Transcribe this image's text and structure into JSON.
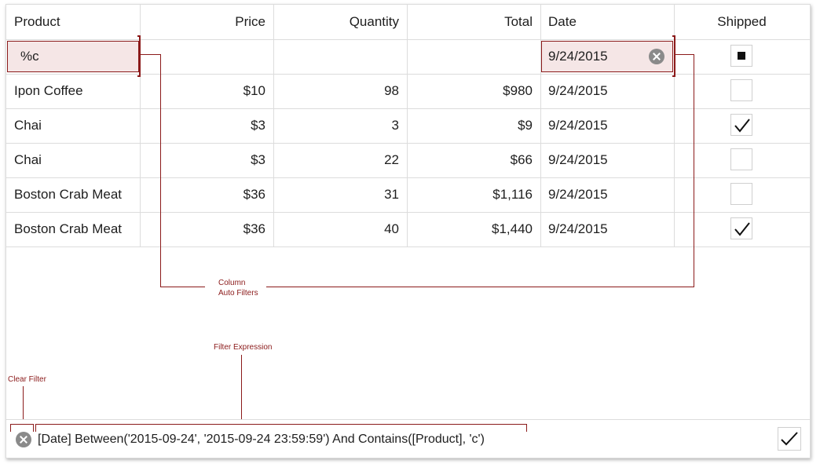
{
  "columns": [
    {
      "label": "Product"
    },
    {
      "label": "Price"
    },
    {
      "label": "Quantity"
    },
    {
      "label": "Total"
    },
    {
      "label": "Date"
    },
    {
      "label": "Shipped"
    }
  ],
  "auto_filter": {
    "product_value": "%c",
    "date_value": "9/24/2015",
    "shipped_state": "indeterminate"
  },
  "rows": [
    {
      "product": "Ipon Coffee",
      "price": "$10",
      "quantity": "98",
      "total": "$980",
      "date": "9/24/2015",
      "shipped": false
    },
    {
      "product": "Chai",
      "price": "$3",
      "quantity": "3",
      "total": "$9",
      "date": "9/24/2015",
      "shipped": true
    },
    {
      "product": "Chai",
      "price": "$3",
      "quantity": "22",
      "total": "$66",
      "date": "9/24/2015",
      "shipped": false
    },
    {
      "product": "Boston Crab Meat",
      "price": "$36",
      "quantity": "31",
      "total": "$1,116",
      "date": "9/24/2015",
      "shipped": false
    },
    {
      "product": "Boston Crab Meat",
      "price": "$36",
      "quantity": "40",
      "total": "$1,440",
      "date": "9/24/2015",
      "shipped": true
    }
  ],
  "annotations": {
    "column_auto_filters_line1": "Column",
    "column_auto_filters_line2": "Auto Filters",
    "filter_expression": "Filter Expression",
    "clear_filter": "Clear Filter"
  },
  "filter_panel": {
    "expression": "[Date] Between('2015-09-24', '2015-09-24 23:59:59') And Contains([Product], 'c')"
  },
  "colors": {
    "accent": "#8b1a1a",
    "filter_fill": "#f5e6e6",
    "grid_line": "#dcdcdc"
  },
  "icons": {
    "clear": "close-circle-icon",
    "check": "checkmark-icon"
  }
}
